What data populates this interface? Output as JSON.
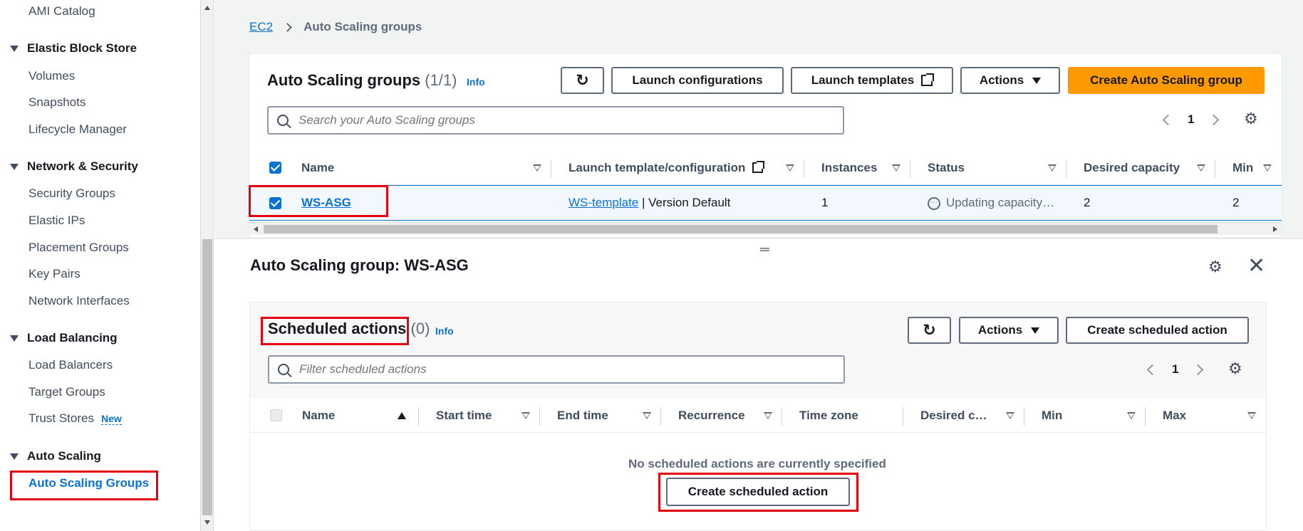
{
  "sidebar": {
    "ami_catalog": "AMI Catalog",
    "ebs_section": "Elastic Block Store",
    "volumes": "Volumes",
    "snapshots": "Snapshots",
    "lifecycle_manager": "Lifecycle Manager",
    "network_section": "Network & Security",
    "security_groups": "Security Groups",
    "elastic_ips": "Elastic IPs",
    "placement_groups": "Placement Groups",
    "key_pairs": "Key Pairs",
    "network_interfaces": "Network Interfaces",
    "lb_section": "Load Balancing",
    "load_balancers": "Load Balancers",
    "target_groups": "Target Groups",
    "trust_stores": "Trust Stores",
    "new_badge": "New",
    "as_section": "Auto Scaling",
    "as_groups": "Auto Scaling Groups"
  },
  "breadcrumb": {
    "root": "EC2",
    "current": "Auto Scaling groups"
  },
  "asg_panel": {
    "title": "Auto Scaling groups",
    "count": "(1/1)",
    "info": "Info",
    "launch_configurations": "Launch configurations",
    "launch_templates": "Launch templates",
    "actions": "Actions",
    "create": "Create Auto Scaling group",
    "search_placeholder": "Search your Auto Scaling groups",
    "page": "1",
    "columns": {
      "name": "Name",
      "launch_template": "Launch template/configuration",
      "instances": "Instances",
      "status": "Status",
      "desired": "Desired capacity",
      "min": "Min"
    },
    "row": {
      "name": "WS-ASG",
      "template_link": "WS-template",
      "template_suffix": " | Version Default",
      "instances": "1",
      "status": "Updating capacity…",
      "desired": "2",
      "min": "2"
    }
  },
  "split_panel": {
    "title": "Auto Scaling group: WS-ASG",
    "scheduled": {
      "title": "Scheduled actions",
      "count": "(0)",
      "info": "Info",
      "actions": "Actions",
      "create": "Create scheduled action",
      "filter_placeholder": "Filter scheduled actions",
      "page": "1",
      "columns": {
        "name": "Name",
        "start": "Start time",
        "end": "End time",
        "recurrence": "Recurrence",
        "timezone": "Time zone",
        "desired": "Desired c…",
        "min": "Min",
        "max": "Max"
      },
      "empty": "No scheduled actions are currently specified",
      "empty_create": "Create scheduled action"
    }
  },
  "colors": {
    "accent": "#0972d3",
    "primary_button": "#ff9900",
    "highlight_box": "#e3000f"
  }
}
